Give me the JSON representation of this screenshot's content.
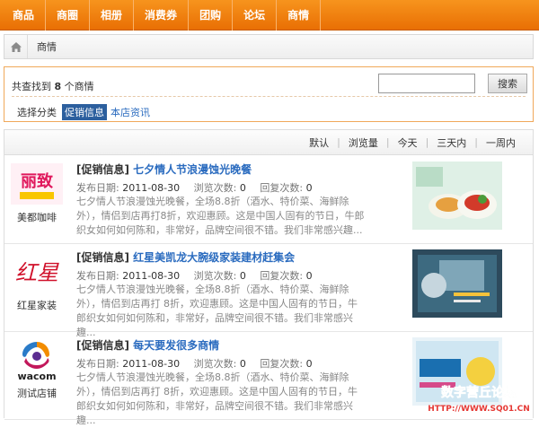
{
  "nav": [
    {
      "label": "商品"
    },
    {
      "label": "商圈"
    },
    {
      "label": "相册"
    },
    {
      "label": "消费券"
    },
    {
      "label": "团购"
    },
    {
      "label": "论坛"
    },
    {
      "label": "商情"
    }
  ],
  "breadcrumb": {
    "current": "商情"
  },
  "search": {
    "found_prefix": "共查找到",
    "found_count": "8",
    "found_suffix": "个商情",
    "button": "搜索",
    "input_value": "",
    "category_label": "选择分类",
    "categories": [
      {
        "label": "促销信息",
        "active": true
      },
      {
        "label": "本店资讯",
        "active": false
      }
    ]
  },
  "sort": [
    "默认",
    "浏览量",
    "今天",
    "三天内",
    "一周内"
  ],
  "items": [
    {
      "tag": "[促销信息]",
      "title": "七夕情人节浪漫蚀光晚餐",
      "store": "美都咖啡",
      "date_label": "发布日期:",
      "date": "2011-08-30",
      "views_label": "浏览次数:",
      "views": "0",
      "replies_label": "回复次数:",
      "replies": "0",
      "desc": "七夕情人节浪漫蚀光晚餐，全场8.8折（酒水、特价菜、海鲜除外），情侣到店再打8折，欢迎惠顾。这是中国人固有的节日，牛郎织女如何如何陈和，非常好，品牌空间很不错。我们非常感兴趣..."
    },
    {
      "tag": "[促销信息]",
      "title": "红星美凯龙大腕级家装建材赶集会",
      "store": "红星家装",
      "date_label": "发布日期:",
      "date": "2011-08-30",
      "views_label": "浏览次数:",
      "views": "0",
      "replies_label": "回复次数:",
      "replies": "0",
      "desc": "七夕情人节浪漫蚀光晚餐，全场8.8折（酒水、特价菜、海鲜除外），情侣到店再打 8折，欢迎惠顾。这是中国人固有的节日，牛郎织女如何如何陈和，非常好，品牌空间很不错。我们非常感兴趣..."
    },
    {
      "tag": "[促销信息]",
      "title": "每天要发很多商情",
      "store": "测试店铺",
      "date_label": "发布日期:",
      "date": "2011-08-30",
      "views_label": "浏览次数:",
      "views": "0",
      "replies_label": "回复次数:",
      "replies": "0",
      "desc": "七夕情人节浪漫蚀光晚餐，全场8.8折（酒水、特价菜、海鲜除外），情侣到店再打 8折，欢迎惠顾。这是中国人固有的节日，牛郎织女如何如何陈和，非常好，品牌空间很不错。我们非常感兴趣..."
    }
  ],
  "logos": {
    "item1": "丽致",
    "item2": "红星",
    "item3": "wacom"
  },
  "watermark": {
    "line1": "数字营丘论坛",
    "line2": "HTTP://WWW.SQ01.CN"
  },
  "colors": {
    "nav_orange": "#f7941d",
    "link_blue": "#2a6bbf",
    "active_blue": "#2c5f9e"
  }
}
